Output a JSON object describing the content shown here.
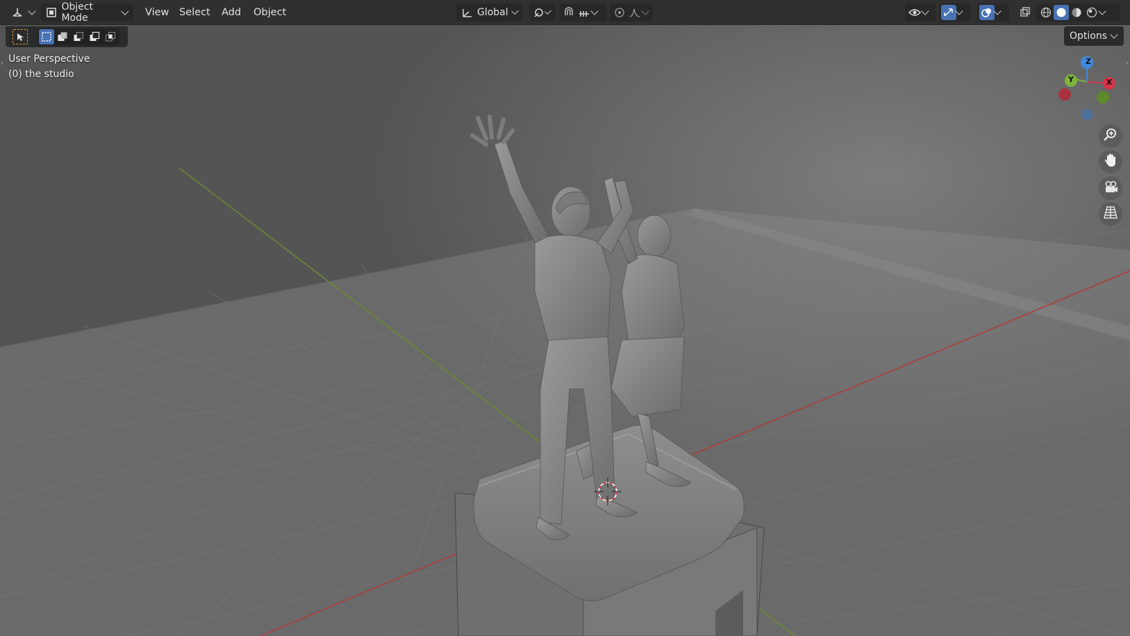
{
  "header": {
    "editor_type_icon": "3d-viewport-icon",
    "mode_label": "Object Mode",
    "menus": [
      "View",
      "Select",
      "Add",
      "Object"
    ],
    "transform_orientation": "Global"
  },
  "toolbar": {
    "options_label": "Options"
  },
  "viewport": {
    "view_name": "User Perspective",
    "collection_info": "(0) the studio"
  },
  "gizmo": {
    "axes": [
      "Z",
      "Y",
      "X"
    ],
    "colors": {
      "x": "#d9324a",
      "y": "#7fb43a",
      "z": "#3f8ae0",
      "neg_x": "#a8333f",
      "neg_y": "#5d8a2b",
      "neg_z": "#4d6f9c"
    }
  },
  "colors": {
    "header_bg": "#303030",
    "accent": "#4772b3",
    "x_axis_line": "#b03a3a",
    "y_axis_line": "#6b8c2c"
  }
}
